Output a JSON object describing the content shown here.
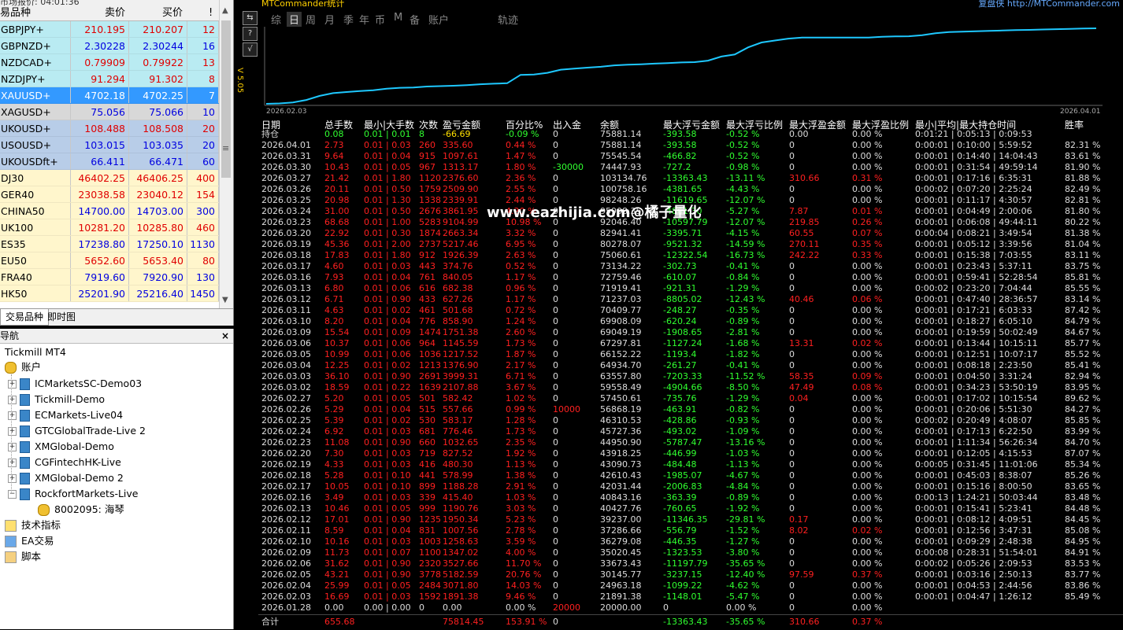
{
  "market_watch": {
    "title": "市场报价: 04:01:36",
    "col_symbol": "易品种",
    "col_bid": "卖价",
    "col_ask": "买价",
    "col_spread": "!",
    "rows": [
      {
        "sym": "GBPJPY+",
        "bid": "210.195",
        "ask": "210.207",
        "spr": "12",
        "bg": "cyan",
        "bc": "red",
        "ac": "red",
        "sc": "red"
      },
      {
        "sym": "GBPNZD+",
        "bid": "2.30228",
        "ask": "2.30244",
        "spr": "16",
        "bg": "cyan",
        "bc": "blu",
        "ac": "blu",
        "sc": "blu"
      },
      {
        "sym": "NZDCAD+",
        "bid": "0.79909",
        "ask": "0.79922",
        "spr": "13",
        "bg": "cyan",
        "bc": "red",
        "ac": "red",
        "sc": "red"
      },
      {
        "sym": "NZDJPY+",
        "bid": "91.294",
        "ask": "91.302",
        "spr": "8",
        "bg": "cyan",
        "bc": "red",
        "ac": "red",
        "sc": "red"
      },
      {
        "sym": "XAUUSD+",
        "bid": "4702.18",
        "ask": "4702.25",
        "spr": "7",
        "bg": "blue",
        "bc": "wht",
        "ac": "wht",
        "sc": "wht"
      },
      {
        "sym": "XAGUSD+",
        "bid": "75.056",
        "ask": "75.066",
        "spr": "10",
        "bg": "gray",
        "bc": "blu",
        "ac": "blu",
        "sc": "blu"
      },
      {
        "sym": "UKOUSD+",
        "bid": "108.488",
        "ask": "108.508",
        "spr": "20",
        "bg": "lblue",
        "bc": "red",
        "ac": "red",
        "sc": "red"
      },
      {
        "sym": "USOUSD+",
        "bid": "103.015",
        "ask": "103.035",
        "spr": "20",
        "bg": "lblue",
        "bc": "blu",
        "ac": "blu",
        "sc": "blu"
      },
      {
        "sym": "UKOUSDft+",
        "bid": "66.411",
        "ask": "66.471",
        "spr": "60",
        "bg": "lblue",
        "bc": "blu",
        "ac": "blu",
        "sc": "blu"
      },
      {
        "sym": "DJ30",
        "bid": "46402.25",
        "ask": "46406.25",
        "spr": "400",
        "bg": "yellow",
        "bc": "red",
        "ac": "red",
        "sc": "red"
      },
      {
        "sym": "GER40",
        "bid": "23038.58",
        "ask": "23040.12",
        "spr": "154",
        "bg": "yellow",
        "bc": "red",
        "ac": "red",
        "sc": "red"
      },
      {
        "sym": "CHINA50",
        "bid": "14700.00",
        "ask": "14703.00",
        "spr": "300",
        "bg": "yellow",
        "bc": "blu",
        "ac": "blu",
        "sc": "blu"
      },
      {
        "sym": "UK100",
        "bid": "10281.20",
        "ask": "10285.80",
        "spr": "460",
        "bg": "yellow",
        "bc": "red",
        "ac": "red",
        "sc": "red"
      },
      {
        "sym": "ES35",
        "bid": "17238.80",
        "ask": "17250.10",
        "spr": "1130",
        "bg": "yellow",
        "bc": "blu",
        "ac": "blu",
        "sc": "blu"
      },
      {
        "sym": "EU50",
        "bid": "5652.60",
        "ask": "5653.40",
        "spr": "80",
        "bg": "yellow",
        "bc": "red",
        "ac": "red",
        "sc": "red"
      },
      {
        "sym": "FRA40",
        "bid": "7919.60",
        "ask": "7920.90",
        "spr": "130",
        "bg": "yellow",
        "bc": "blu",
        "ac": "blu",
        "sc": "blu"
      },
      {
        "sym": "HK50",
        "bid": "25201.90",
        "ask": "25216.40",
        "spr": "1450",
        "bg": "yellow",
        "bc": "blu",
        "ac": "blu",
        "sc": "blu"
      }
    ],
    "tab_symbols": "交易品种",
    "tab_tick": "即时图"
  },
  "navigator": {
    "title": "导航",
    "root": "Tickmill MT4",
    "accounts_label": "账户",
    "accounts": [
      "ICMarketsSC-Demo03",
      "Tickmill-Demo",
      "ECMarkets-Live04",
      "GTCGlobalTrade-Live 2",
      "XMGlobal-Demo",
      "CGFintechHK-Live",
      "XMGlobal-Demo 2",
      "RockfortMarkets-Live"
    ],
    "sub_account": "8002095: 海琴",
    "indicators": "技术指标",
    "ea": "EA交易",
    "scripts": "脚本"
  },
  "header": {
    "title": "MTCommander统计",
    "credit": "复盘侠 http://MTCommander.com",
    "version": "V 5.05",
    "tabs": [
      "综",
      "日",
      "周",
      "月",
      "季",
      "年",
      "币",
      "M",
      "备",
      "账户",
      "轨迹"
    ],
    "active_tab": 1
  },
  "equity_chart": {
    "x_start": "2026.02.03",
    "x_end": "2026.04.01",
    "values": [
      20000,
      20500,
      21800,
      24960,
      30145,
      33673,
      35020,
      36279,
      37286,
      39237,
      40427,
      40843,
      42031,
      42610,
      43090,
      43918,
      44950,
      45727,
      46310,
      56868,
      57450,
      59558,
      63557,
      64934,
      66152,
      67297,
      69049,
      69908,
      70409,
      71237,
      71919,
      72759,
      73134,
      75060,
      80278,
      82941,
      92046,
      98248,
      100758,
      103134,
      104447,
      104447,
      104447,
      104447,
      104447,
      104447,
      105545,
      106000,
      106200,
      107500,
      110000,
      111500,
      112000,
      112600,
      113000,
      113500,
      114000,
      114300,
      114800,
      115200,
      115600,
      116000,
      116300
    ]
  },
  "table": {
    "headers": [
      "日期",
      "总手数",
      "最小|大手数",
      "次数",
      "盈亏金额",
      "百分比%",
      "出入金",
      "余额",
      "最大浮亏金额",
      "最大浮亏比例",
      "最大浮盈金额",
      "最大浮盈比例",
      "最小|平均|最大持仓时间",
      "胜率"
    ],
    "holding": {
      "label": "持仓",
      "lots": "0.08",
      "minmax": "0.01 | 0.01",
      "count": "8",
      "pl": "-66.69",
      "pct": "-0.09 %",
      "inout": "0",
      "bal": "75881.14",
      "mfl": "-393.58",
      "mflp": "-0.52 %",
      "mfp": "0.00",
      "mfpp": "0.00 %",
      "time": "0:01:21 | 0:05:13 | 0:09:53",
      "win": ""
    },
    "rows": [
      [
        "2026.04.01",
        "2.73",
        "0.01 | 0.03",
        "260",
        "335.60",
        "0.44 %",
        "0",
        "75881.14",
        "-393.58",
        "-0.52 %",
        "0",
        "0.00 %",
        "0:00:01 | 0:10:00 | 5:59:52",
        "82.31 %"
      ],
      [
        "2026.03.31",
        "9.64",
        "0.01 | 0.04",
        "915",
        "1097.61",
        "1.47 %",
        "0",
        "75545.54",
        "-466.82",
        "-0.52 %",
        "0",
        "0.00 %",
        "0:00:01 | 0:14:40 | 14:04:43",
        "83.61 %"
      ],
      [
        "2026.03.30",
        "10.43",
        "0.01 | 0.05",
        "967",
        "1313.17",
        "1.80 %",
        "-30000",
        "74447.93",
        "-727.2",
        "-0.98 %",
        "0",
        "0.00 %",
        "0:00:01 | 0:31:54 | 49:59:14",
        "81.90 %"
      ],
      [
        "2026.03.27",
        "21.42",
        "0.01 | 1.80",
        "1120",
        "2376.60",
        "2.36 %",
        "0",
        "103134.76",
        "-13363.43",
        "-13.11 %",
        "310.66",
        "0.31 %",
        "0:00:01 | 0:17:16 | 6:35:31",
        "81.88 %"
      ],
      [
        "2026.03.26",
        "20.11",
        "0.01 | 0.50",
        "1759",
        "2509.90",
        "2.55 %",
        "0",
        "100758.16",
        "-4381.65",
        "-4.43 %",
        "0",
        "0.00 %",
        "0:00:02 | 0:07:20 | 2:25:24",
        "82.49 %"
      ],
      [
        "2026.03.25",
        "20.98",
        "0.01 | 1.30",
        "1338",
        "2339.91",
        "2.44 %",
        "0",
        "98248.26",
        "-11619.65",
        "-12.07 %",
        "0",
        "0.00 %",
        "0:00:01 | 0:11:17 | 4:30:57",
        "82.81 %"
      ],
      [
        "2026.03.24",
        "31.00",
        "0.01 | 0.50",
        "2676",
        "3861.95",
        "4.20 %",
        "0",
        "95908.35",
        "-4861.30",
        "-5.27 %",
        "7.87",
        "0.01 %",
        "0:00:01 | 0:04:49 | 2:00:06",
        "81.80 %"
      ],
      [
        "2026.03.23",
        "68.68",
        "0.01 | 1.00",
        "5283",
        "9104.99",
        "10.98 %",
        "0",
        "92046.40",
        "-10597.79",
        "-12.07 %",
        "219.85",
        "0.26 %",
        "0:00:01 | 0:06:08 | 49:44:11",
        "80.22 %"
      ],
      [
        "2026.03.20",
        "22.92",
        "0.01 | 0.30",
        "1874",
        "2663.34",
        "3.32 %",
        "0",
        "82941.41",
        "-3395.71",
        "-4.15 %",
        "60.55",
        "0.07 %",
        "0:00:04 | 0:08:21 | 3:49:54",
        "81.38 %"
      ],
      [
        "2026.03.19",
        "45.36",
        "0.01 | 2.00",
        "2737",
        "5217.46",
        "6.95 %",
        "0",
        "80278.07",
        "-9521.32",
        "-14.59 %",
        "270.11",
        "0.35 %",
        "0:00:01 | 0:05:12 | 3:39:56",
        "81.04 %"
      ],
      [
        "2026.03.18",
        "17.83",
        "0.01 | 1.80",
        "912",
        "1926.39",
        "2.63 %",
        "0",
        "75060.61",
        "-12322.54",
        "-16.73 %",
        "242.22",
        "0.33 %",
        "0:00:01 | 0:15:38 | 7:03:55",
        "83.11 %"
      ],
      [
        "2026.03.17",
        "4.60",
        "0.01 | 0.03",
        "443",
        "374.76",
        "0.52 %",
        "0",
        "73134.22",
        "-302.73",
        "-0.41 %",
        "0",
        "0.00 %",
        "0:00:01 | 0:23:43 | 5:37:11",
        "83.75 %"
      ],
      [
        "2026.03.16",
        "7.93",
        "0.01 | 0.04",
        "761",
        "840.05",
        "1.17 %",
        "0",
        "72759.46",
        "-610.07",
        "-0.84 %",
        "0",
        "0.00 %",
        "0:00:01 | 0:59:41 | 52:28:54",
        "85.81 %"
      ],
      [
        "2026.03.13",
        "6.80",
        "0.01 | 0.06",
        "616",
        "682.38",
        "0.96 %",
        "0",
        "71919.41",
        "-921.31",
        "-1.29 %",
        "0",
        "0.00 %",
        "0:00:02 | 0:23:20 | 7:04:44",
        "85.55 %"
      ],
      [
        "2026.03.12",
        "6.71",
        "0.01 | 0.90",
        "433",
        "627.26",
        "1.17 %",
        "0",
        "71237.03",
        "-8805.02",
        "-12.43 %",
        "40.46",
        "0.06 %",
        "0:00:01 | 0:47:40 | 28:36:57",
        "83.14 %"
      ],
      [
        "2026.03.11",
        "4.63",
        "0.01 | 0.02",
        "461",
        "501.68",
        "0.72 %",
        "0",
        "70409.77",
        "-248.27",
        "-0.35 %",
        "0",
        "0.00 %",
        "0:00:01 | 0:17:21 | 6:03:33",
        "87.42 %"
      ],
      [
        "2026.03.10",
        "8.20",
        "0.01 | 0.04",
        "776",
        "858.90",
        "1.24 %",
        "0",
        "69908.09",
        "-620.24",
        "-0.89 %",
        "0",
        "0.00 %",
        "0:00:01 | 0:18:27 | 6:05:10",
        "84.79 %"
      ],
      [
        "2026.03.09",
        "15.54",
        "0.01 | 0.09",
        "1474",
        "1751.38",
        "2.60 %",
        "0",
        "69049.19",
        "-1908.65",
        "-2.81 %",
        "0",
        "0.00 %",
        "0:00:01 | 0:19:59 | 50:02:49",
        "84.67 %"
      ],
      [
        "2026.03.06",
        "10.37",
        "0.01 | 0.06",
        "964",
        "1145.59",
        "1.73 %",
        "0",
        "67297.81",
        "-1127.24",
        "-1.68 %",
        "13.31",
        "0.02 %",
        "0:00:01 | 0:13:44 | 10:15:11",
        "85.77 %"
      ],
      [
        "2026.03.05",
        "10.99",
        "0.01 | 0.06",
        "1036",
        "1217.52",
        "1.87 %",
        "0",
        "66152.22",
        "-1193.4",
        "-1.82 %",
        "0",
        "0.00 %",
        "0:00:01 | 0:12:51 | 10:07:17",
        "85.52 %"
      ],
      [
        "2026.03.04",
        "12.25",
        "0.01 | 0.02",
        "1213",
        "1376.90",
        "2.17 %",
        "0",
        "64934.70",
        "-261.27",
        "-0.41 %",
        "0",
        "0.00 %",
        "0:00:01 | 0:08:18 | 2:23:50",
        "85.41 %"
      ],
      [
        "2026.03.03",
        "36.10",
        "0.01 | 0.90",
        "2691",
        "3999.31",
        "6.71 %",
        "0",
        "63557.80",
        "-7203.33",
        "-11.52 %",
        "58.35",
        "0.09 %",
        "0:00:01 | 0:04:50 | 3:31:24",
        "82.94 %"
      ],
      [
        "2026.03.02",
        "18.59",
        "0.01 | 0.22",
        "1639",
        "2107.88",
        "3.67 %",
        "0",
        "59558.49",
        "-4904.66",
        "-8.50 %",
        "47.49",
        "0.08 %",
        "0:00:01 | 0:34:23 | 53:50:19",
        "83.95 %"
      ],
      [
        "2026.02.27",
        "5.20",
        "0.01 | 0.05",
        "501",
        "582.42",
        "1.02 %",
        "0",
        "57450.61",
        "-735.76",
        "-1.29 %",
        "0.04",
        "0.00 %",
        "0:00:01 | 0:17:02 | 10:15:54",
        "89.62 %"
      ],
      [
        "2026.02.26",
        "5.29",
        "0.01 | 0.04",
        "515",
        "557.66",
        "0.99 %",
        "10000",
        "56868.19",
        "-463.91",
        "-0.82 %",
        "0",
        "0.00 %",
        "0:00:01 | 0:20:06 | 5:51:30",
        "84.27 %"
      ],
      [
        "2026.02.25",
        "5.39",
        "0.01 | 0.02",
        "530",
        "583.17",
        "1.28 %",
        "0",
        "46310.53",
        "-428.86",
        "-0.93 %",
        "0",
        "0.00 %",
        "0:00:02 | 0:20:49 | 4:08:07",
        "85.85 %"
      ],
      [
        "2026.02.24",
        "6.92",
        "0.01 | 0.03",
        "681",
        "776.46",
        "1.73 %",
        "0",
        "45727.36",
        "-493.02",
        "-1.09 %",
        "0",
        "0.00 %",
        "0:00:01 | 0:17:13 | 6:22:50",
        "83.99 %"
      ],
      [
        "2026.02.23",
        "11.08",
        "0.01 | 0.90",
        "660",
        "1032.65",
        "2.35 %",
        "0",
        "44950.90",
        "-5787.47",
        "-13.16 %",
        "0",
        "0.00 %",
        "0:00:01 | 1:11:34 | 56:26:34",
        "84.70 %"
      ],
      [
        "2026.02.20",
        "7.30",
        "0.01 | 0.03",
        "719",
        "827.52",
        "1.92 %",
        "0",
        "43918.25",
        "-446.99",
        "-1.03 %",
        "0",
        "0.00 %",
        "0:00:01 | 0:12:05 | 4:15:53",
        "87.07 %"
      ],
      [
        "2026.02.19",
        "4.33",
        "0.01 | 0.03",
        "416",
        "480.30",
        "1.13 %",
        "0",
        "43090.73",
        "-484.48",
        "-1.13 %",
        "0",
        "0.00 %",
        "0:00:05 | 0:31:45 | 11:01:06",
        "85.34 %"
      ],
      [
        "2026.02.18",
        "5.28",
        "0.01 | 0.10",
        "441",
        "578.99",
        "1.38 %",
        "0",
        "42610.43",
        "-1985.07",
        "-4.67 %",
        "0",
        "0.00 %",
        "0:00:01 | 0:45:03 | 8:38:07",
        "85.26 %"
      ],
      [
        "2026.02.17",
        "10.05",
        "0.01 | 0.10",
        "899",
        "1188.28",
        "2.91 %",
        "0",
        "42031.44",
        "-2006.83",
        "-4.84 %",
        "0",
        "0.00 %",
        "0:00:01 | 0:15:16 | 8:00:50",
        "83.65 %"
      ],
      [
        "2026.02.16",
        "3.49",
        "0.01 | 0.03",
        "339",
        "415.40",
        "1.03 %",
        "0",
        "40843.16",
        "-363.39",
        "-0.89 %",
        "0",
        "0.00 %",
        "0:00:13 | 1:24:21 | 50:03:44",
        "83.48 %"
      ],
      [
        "2026.02.13",
        "10.46",
        "0.01 | 0.05",
        "999",
        "1190.76",
        "3.03 %",
        "0",
        "40427.76",
        "-760.65",
        "-1.92 %",
        "0",
        "0.00 %",
        "0:00:01 | 0:15:41 | 5:23:41",
        "84.48 %"
      ],
      [
        "2026.02.12",
        "17.01",
        "0.01 | 0.90",
        "1235",
        "1950.34",
        "5.23 %",
        "0",
        "39237.00",
        "-11346.35",
        "-29.81 %",
        "0.17",
        "0.00 %",
        "0:00:01 | 0:08:12 | 4:09:51",
        "84.45 %"
      ],
      [
        "2026.02.11",
        "8.59",
        "0.01 | 0.04",
        "831",
        "1007.56",
        "2.78 %",
        "0",
        "37286.66",
        "-556.79",
        "-1.52 %",
        "8.02",
        "0.02 %",
        "0:00:01 | 0:12:56 | 3:47:31",
        "85.08 %"
      ],
      [
        "2026.02.10",
        "10.16",
        "0.01 | 0.03",
        "1003",
        "1258.63",
        "3.59 %",
        "0",
        "36279.08",
        "-446.35",
        "-1.27 %",
        "0",
        "0.00 %",
        "0:00:01 | 0:09:29 | 2:48:38",
        "84.95 %"
      ],
      [
        "2026.02.09",
        "11.73",
        "0.01 | 0.07",
        "1100",
        "1347.02",
        "4.00 %",
        "0",
        "35020.45",
        "-1323.53",
        "-3.80 %",
        "0",
        "0.00 %",
        "0:00:08 | 0:28:31 | 51:54:01",
        "84.91 %"
      ],
      [
        "2026.02.06",
        "31.62",
        "0.01 | 0.90",
        "2320",
        "3527.66",
        "11.70 %",
        "0",
        "33673.43",
        "-11197.79",
        "-35.65 %",
        "0",
        "0.00 %",
        "0:00:02 | 0:05:26 | 2:09:53",
        "83.53 %"
      ],
      [
        "2026.02.05",
        "43.21",
        "0.01 | 0.90",
        "3778",
        "5182.59",
        "20.76 %",
        "0",
        "30145.77",
        "-3237.15",
        "-12.40 %",
        "97.59",
        "0.37 %",
        "0:00:01 | 0:03:16 | 2:50:13",
        "83.77 %"
      ],
      [
        "2026.02.04",
        "25.99",
        "0.01 | 0.05",
        "2484",
        "3071.80",
        "14.03 %",
        "0",
        "24963.18",
        "-1099.22",
        "-4.62 %",
        "0",
        "0.00 %",
        "0:00:01 | 0:04:53 | 2:44:56",
        "83.86 %"
      ],
      [
        "2026.02.03",
        "16.69",
        "0.01 | 0.03",
        "1592",
        "1891.38",
        "9.46 %",
        "0",
        "21891.38",
        "-1148.01",
        "-5.47 %",
        "0",
        "0.00 %",
        "0:00:01 | 0:04:47 | 1:26:12",
        "85.49 %"
      ],
      [
        "2026.01.28",
        "0.00",
        "0.00 | 0.00",
        "0",
        "0.00",
        "0.00 %",
        "20000",
        "20000.00",
        "0",
        "0.00 %",
        "0",
        "0.00 %",
        "",
        ""
      ]
    ],
    "total": {
      "label": "合计",
      "lots": "655.68",
      "pl": "75814.45",
      "pct": "153.91 %",
      "inout": "0",
      "mfl": "-13363.43",
      "mflp": "-35.65 %",
      "mfp": "310.66",
      "mfpp": "0.37 %"
    }
  },
  "watermark": "www.eazhijia.com@橘子量化",
  "colors": {
    "cyan_line": "#1ec8ff",
    "red": "#ff2020",
    "green": "#30ff30",
    "yellow": "#ffe000"
  }
}
